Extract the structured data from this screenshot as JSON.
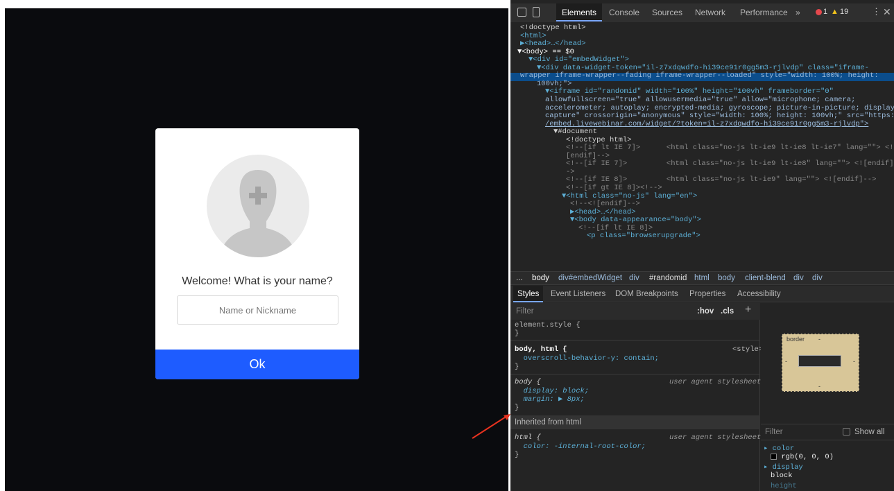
{
  "login_widget": {
    "welcome_text": "Welcome! What is your name?",
    "name_placeholder": "Name or Nickname",
    "ok_label": "Ok"
  },
  "devtools": {
    "tabs": [
      "Elements",
      "Console",
      "Sources",
      "Network",
      "Performance",
      "»"
    ],
    "error_count": "1",
    "warning_count": "19",
    "dom_lines": [
      "<!doctype html>",
      "<html>",
      "▶<head>…</head>",
      "▼<body> == $0",
      "▼<div id=\"embedWidget\">",
      "▼<div data-widget-token=\"il-z7xdqwdfo-hi39ce91r0gg5m3-rjlvdp\" class=\"iframe-",
      "wrapper iframe-wrapper--fading iframe-wrapper--loaded\" style=\"width: 100%; height:",
      "100vh;\">",
      "▼<iframe id=\"randomid\" width=\"100%\" height=\"100vh\" frameborder=\"0\"",
      "allowfullscreen=\"true\" allowusermedia=\"true\" allow=\"microphone; camera;",
      "accelerometer; autoplay; encrypted-media; gyroscope; picture-in-picture; display-",
      "capture\" crossorigin=\"anonymous\" style=\"width: 100%; height: 100vh;\" src=\"https:/",
      "/embed.livewebinar.com/widget/?token=il-z7xdqwdfo-hi39ce91r0gg5m3-rjlvdp\">",
      "▼#document",
      "<!doctype html>",
      "<!--[if lt IE 7]>      <html class=\"no-js lt-ie9 lt-ie8 lt-ie7\" lang=\"\"> <!",
      "[endif]-->",
      "<!--[if IE 7]>         <html class=\"no-js lt-ie9 lt-ie8\" lang=\"\"> <![endif]-",
      "->",
      "<!--[if IE 8]>         <html class=\"no-js lt-ie9\" lang=\"\"> <![endif]-->",
      "<!--[if gt IE 8]><!-->",
      "▼<html class=\"no-js\" lang=\"en\">",
      "<!--<![endif]-->",
      "▶<head>…</head>",
      "▼<body data-appearance=\"body\">",
      "<!--[if lt IE 8]>",
      "<p class=\"browserupgrade\">"
    ],
    "breadcrumbs": [
      "...",
      "body",
      "div#embedWidget",
      "div",
      "#randomid",
      "html",
      "body",
      "client-blend",
      "div",
      "div"
    ],
    "subtabs": [
      "Styles",
      "Event Listeners",
      "DOM Breakpoints",
      "Properties",
      "Accessibility"
    ],
    "filter_placeholder": "Filter",
    "hov_label": ":hov",
    "cls_label": ".cls",
    "style_lines": [
      "element.style {",
      "}",
      "body, html {",
      "<style>",
      "  overscroll-behavior-y: contain;",
      "}",
      "body {",
      "user agent stylesheet",
      "  display: block;",
      "  margin: ▶ 8px;",
      "}",
      "Inherited from html",
      "html {",
      "user agent stylesheet",
      "  color: -internal-root-color;",
      "}"
    ],
    "computed": {
      "boxmodel_label": "border",
      "boxmodel_dash": "-",
      "filter_label": "Filter",
      "show_all_label": "Show all",
      "props": [
        {
          "name": "color",
          "value": "rgb(0, 0, 0)"
        },
        {
          "name": "display",
          "value": "block"
        },
        {
          "name": "height",
          "value": ""
        }
      ]
    }
  },
  "colors": {
    "ok_button": "#1e5cff",
    "selection_row": "#0b4d8c",
    "annotation_arrow": "#e8321f"
  }
}
